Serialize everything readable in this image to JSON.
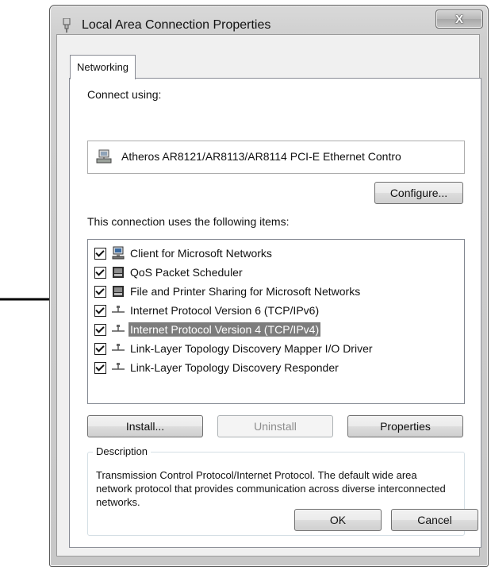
{
  "window": {
    "title": "Local Area Connection Properties",
    "close_label": "X",
    "title_icon": "network-adapter-icon"
  },
  "tabs": [
    {
      "label": "Networking",
      "selected": true
    }
  ],
  "connect_using": {
    "label": "Connect using:",
    "adapter": "Atheros AR8121/AR8113/AR8114 PCI-E Ethernet Contro",
    "adapter_icon": "network-adapter-icon"
  },
  "buttons": {
    "configure": "Configure...",
    "install": "Install...",
    "uninstall": "Uninstall",
    "properties": "Properties",
    "ok": "OK",
    "cancel": "Cancel"
  },
  "items_label": "This connection uses the following items:",
  "items": [
    {
      "label": "Client for Microsoft Networks",
      "checked": true,
      "icon": "network-client-icon",
      "selected": false
    },
    {
      "label": "QoS Packet Scheduler",
      "checked": true,
      "icon": "service-icon",
      "selected": false
    },
    {
      "label": "File and Printer Sharing for Microsoft Networks",
      "checked": true,
      "icon": "service-icon",
      "selected": false
    },
    {
      "label": "Internet Protocol Version 6 (TCP/IPv6)",
      "checked": true,
      "icon": "protocol-icon",
      "selected": false
    },
    {
      "label": "Internet Protocol Version 4 (TCP/IPv4)",
      "checked": true,
      "icon": "protocol-icon",
      "selected": true
    },
    {
      "label": "Link-Layer Topology Discovery Mapper I/O Driver",
      "checked": true,
      "icon": "protocol-icon",
      "selected": false
    },
    {
      "label": "Link-Layer Topology Discovery Responder",
      "checked": true,
      "icon": "protocol-icon",
      "selected": false
    }
  ],
  "description": {
    "legend": "Description",
    "text": "Transmission Control Protocol/Internet Protocol. The default wide area network protocol that provides communication across diverse interconnected networks."
  },
  "colors": {
    "selection": "#7d7d7d",
    "client_bg": "#f0f0f0"
  }
}
